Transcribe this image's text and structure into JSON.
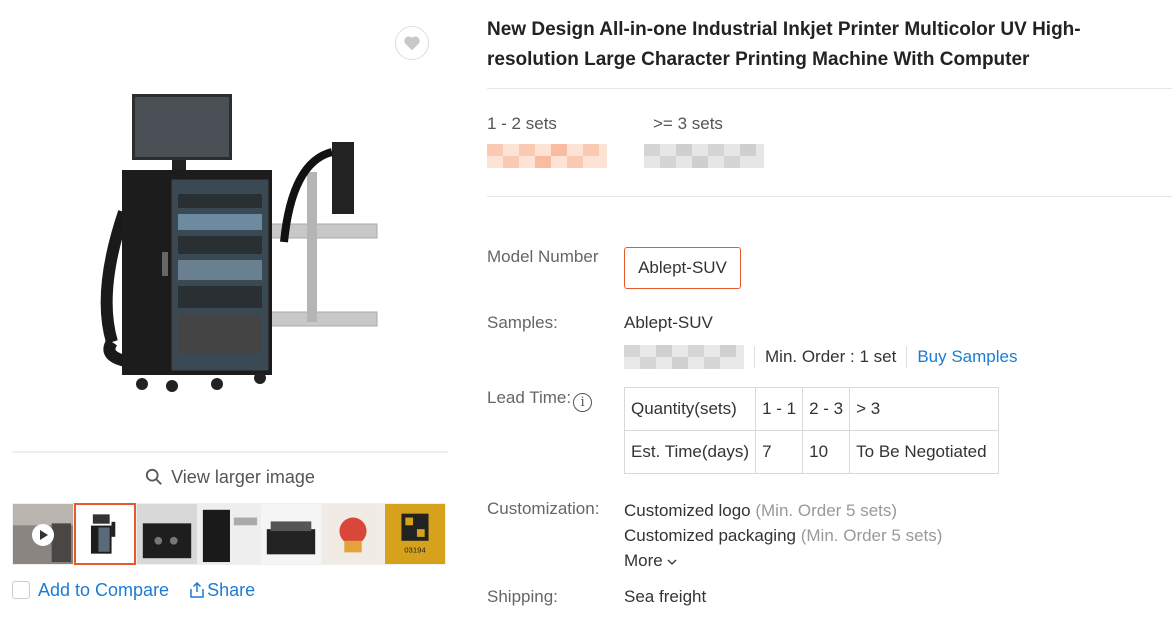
{
  "gallery": {
    "view_larger_label": "View larger image",
    "compare_label": "Add to Compare",
    "share_label": "Share",
    "thumb_qr_text": "03194"
  },
  "product": {
    "title": "New Design All-in-one Industrial Inkjet Printer Multicolor UV High-resolution Large Character Printing Machine With Computer",
    "price_tiers": [
      {
        "quantity": "1 - 2 sets"
      },
      {
        "quantity": ">= 3 sets"
      }
    ],
    "model_number_label": "Model Number",
    "model_number_value": "Ablept-SUV",
    "samples_label": "Samples:",
    "samples_value": "Ablept-SUV",
    "samples_min_order": "Min. Order : 1 set",
    "buy_samples_label": "Buy Samples",
    "lead_time_label": "Lead Time:",
    "lead_time_table": {
      "header": [
        "Quantity(sets)",
        "1 - 1",
        "2 - 3",
        "> 3"
      ],
      "row": [
        "Est. Time(days)",
        "7",
        "10",
        "To Be Negotiated"
      ]
    },
    "customization_label": "Customization:",
    "customizations": [
      {
        "name": "Customized logo",
        "note": "(Min. Order 5 sets)"
      },
      {
        "name": "Customized packaging",
        "note": "(Min. Order 5 sets)"
      }
    ],
    "more_label": "More",
    "shipping_label": "Shipping:",
    "shipping_value": "Sea freight"
  },
  "colors": {
    "accent": "#e8592b",
    "link": "#1c7cd5"
  }
}
